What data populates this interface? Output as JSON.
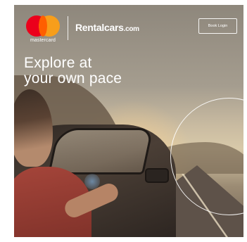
{
  "header": {
    "mastercard_label": "mastercard",
    "brand_name": "Rentalcars",
    "brand_suffix": ".com",
    "book_button_label": "Book Login"
  },
  "hero": {
    "headline_line1": "Explore at",
    "headline_line2": "your own pace"
  },
  "colors": {
    "mastercard_red": "#eb001b",
    "mastercard_orange": "#f79e1b",
    "overlay_text": "#ffffff"
  }
}
